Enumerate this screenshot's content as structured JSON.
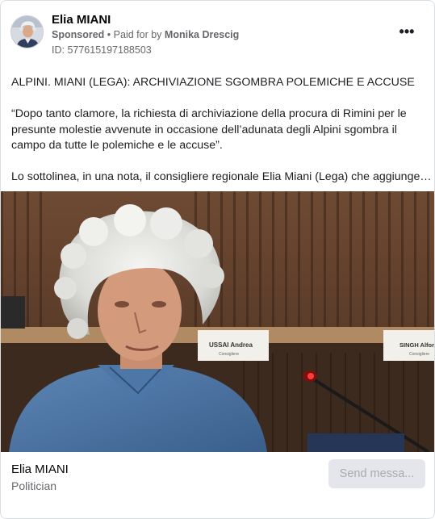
{
  "post": {
    "page_name": "Elia MIANI",
    "sponsored_label": "Sponsored",
    "separator": "•",
    "paid_for_label": "Paid for by",
    "payer": "Monika Drescig",
    "ad_id": "ID: 577615197188503",
    "more_icon": "more-horizontal-icon",
    "more_label": "•••"
  },
  "body": {
    "headline": "ALPINI. MIANI (LEGA): ARCHIVIAZIONE SGOMBRA POLEMICHE E ACCUSE",
    "quote": "“Dopo tanto clamore, la richiesta di archiviazione della procura di Rimini per le presunte molestie avvenute in occasione dell’adunata degli Alpini sgombra il campo da tutte le polemiche e le accuse”.",
    "excerpt": "Lo sottolinea, in una nota, il consigliere regionale Elia Miani (Lega) che aggiunge…"
  },
  "media": {
    "nameplates": [
      {
        "name": "USSAI Andrea",
        "role": "Consigliere"
      },
      {
        "name": "SINGH Alfonso",
        "role": "Consigliere"
      }
    ]
  },
  "footer": {
    "name": "Elia MIANI",
    "category": "Politician",
    "cta_label": "Send messa..."
  },
  "colors": {
    "secondary_text": "#65676b",
    "cta_background": "#e4e6eb",
    "cta_text": "#a7aaaf",
    "border": "#dadde1"
  }
}
